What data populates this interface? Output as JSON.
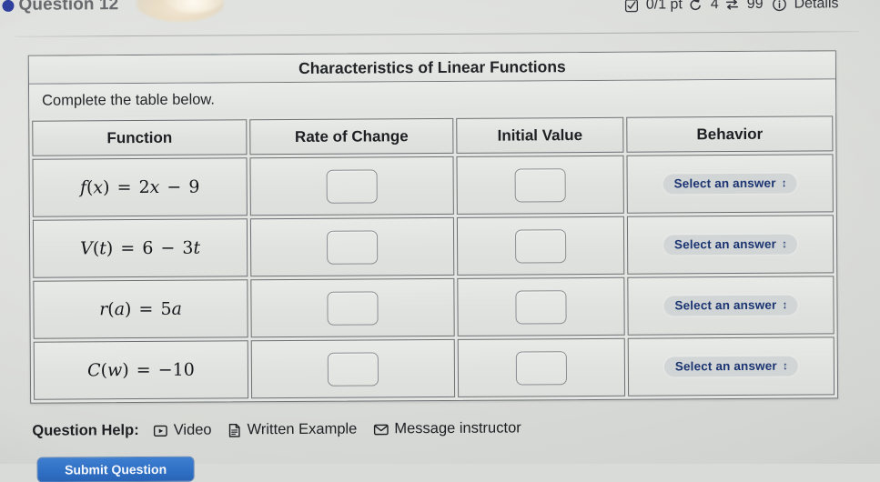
{
  "header": {
    "question_label": "Question 12",
    "bullet_icon": "blue-dot-icon",
    "score": "0/1 pt",
    "score_icon": "checkbox-checked-icon",
    "attempts_icon": "retry-arrow-icon",
    "attempts": "4",
    "shuffle_icon": "swap-arrows-icon",
    "shuffle_count": "99",
    "details_icon": "info-circle-icon",
    "details_label": "Details"
  },
  "panel": {
    "title": "Characteristics of Linear Functions",
    "prompt": "Complete the table below."
  },
  "table": {
    "columns": [
      "Function",
      "Rate of Change",
      "Initial Value",
      "Behavior"
    ],
    "rows": [
      {
        "function_parts": {
          "name": "f",
          "var": "x",
          "eq": "=",
          "expr_coef": "2",
          "expr_var": "x",
          "expr_op": "−",
          "expr_const": "9"
        },
        "function_text": "f(x) = 2x − 9",
        "rate_of_change": "",
        "initial_value": "",
        "behavior": "Select an answer"
      },
      {
        "function_parts": {
          "name": "V",
          "var": "t",
          "eq": "=",
          "expr_coef": "6",
          "expr_var": "",
          "expr_op": "−",
          "expr_const": "3t"
        },
        "function_text": "V(t) = 6 − 3t",
        "rate_of_change": "",
        "initial_value": "",
        "behavior": "Select an answer"
      },
      {
        "function_parts": {
          "name": "r",
          "var": "a",
          "eq": "=",
          "expr_coef": "5a",
          "expr_var": "",
          "expr_op": "",
          "expr_const": ""
        },
        "function_text": "r(a) = 5a",
        "rate_of_change": "",
        "initial_value": "",
        "behavior": "Select an answer"
      },
      {
        "function_parts": {
          "name": "C",
          "var": "w",
          "eq": "=",
          "expr_coef": "−10",
          "expr_var": "",
          "expr_op": "",
          "expr_const": ""
        },
        "function_text": "C(w) = −10",
        "rate_of_change": "",
        "initial_value": "",
        "behavior": "Select an answer"
      }
    ],
    "dropdown_chevron": "chevron-up-down-icon"
  },
  "help": {
    "label": "Question Help:",
    "links": [
      {
        "icon": "video-play-icon",
        "label": "Video"
      },
      {
        "icon": "document-icon",
        "label": "Written Example"
      },
      {
        "icon": "envelope-icon",
        "label": "Message instructor"
      }
    ]
  },
  "footer": {
    "submit_label": "Submit Question"
  },
  "colors": {
    "accent_blue": "#2f6fc4",
    "link_navy": "#1b3572",
    "bullet_blue": "#2f3f9e",
    "panel_bg": "#e3e5e2",
    "border_gray": "#6c7073"
  }
}
